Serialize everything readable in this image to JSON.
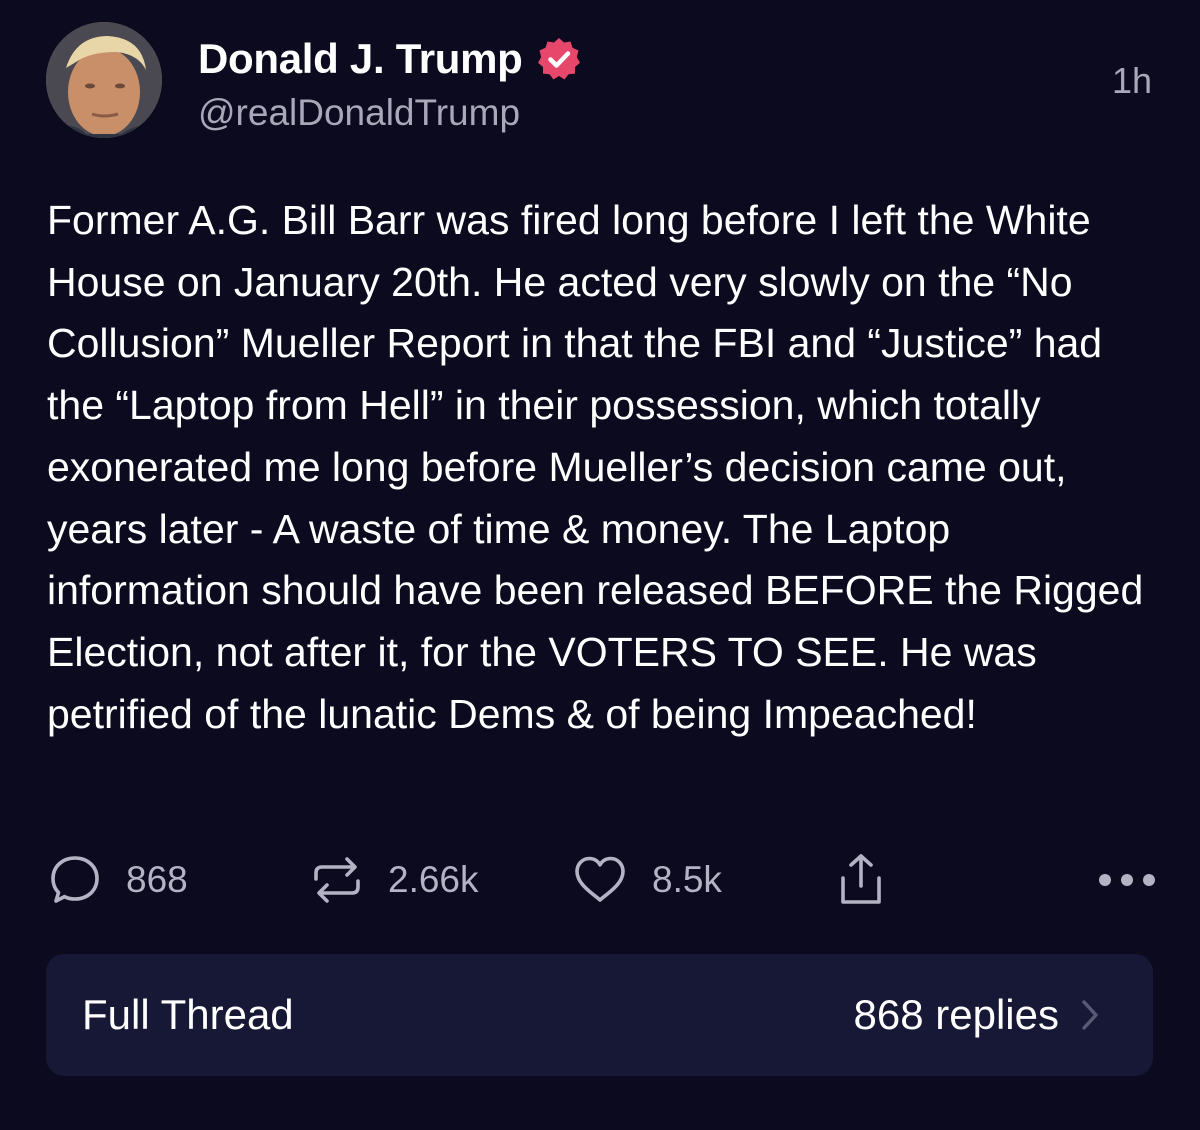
{
  "author": {
    "display_name": "Donald J. Trump",
    "handle": "@realDonaldTrump",
    "verified_icon": "verified-badge-icon",
    "verified_color": "#e6476b"
  },
  "timestamp": "1h",
  "post": {
    "text": "Former A.G. Bill Barr was fired long before I left the White House on January 20th. He acted very slowly on the “No Collusion” Mueller Report in that the FBI and “Justice” had the “Laptop from Hell” in their possession, which totally exonerated me long before Mueller’s decision came out, years later - A waste of time & money. The Laptop information should have been released BEFORE the Rigged Election, not after it, for the VOTERS TO SEE. He was petrified of the lunatic Dems & of being Impeached!"
  },
  "actions": {
    "reply_count": "868",
    "repost_count": "2.66k",
    "like_count": "8.5k"
  },
  "thread": {
    "label": "Full Thread",
    "replies": "868 replies"
  },
  "colors": {
    "background": "#0b0a1f",
    "thread_bar": "#171736",
    "muted_text": "#a9a8b8"
  }
}
